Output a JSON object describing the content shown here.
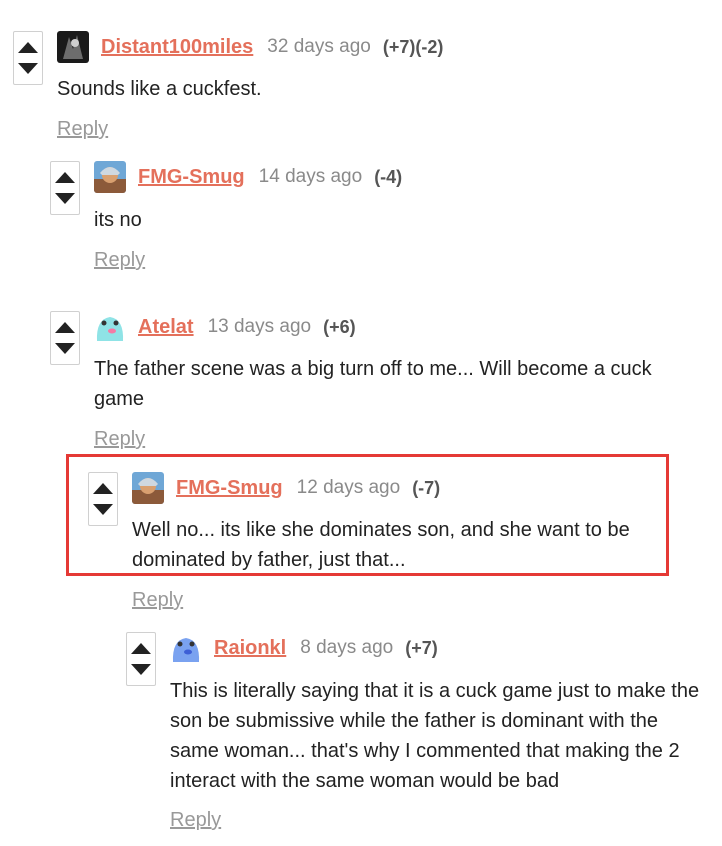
{
  "comments": [
    {
      "user": "Distant100miles",
      "time": "32 days ago",
      "score": "(+7)(-2)",
      "text": "Sounds like a cuckfest.",
      "reply": "Reply",
      "avatar": "dark-avatar"
    },
    {
      "user": "FMG-Smug",
      "time": "14 days ago",
      "score": "(-4)",
      "text": "its no",
      "reply": "Reply",
      "avatar": "knight-avatar"
    },
    {
      "user": "Atelat",
      "time": "13 days ago",
      "score": "(+6)",
      "text": "The father scene was a big turn off to me... Will become a cuck game",
      "reply": "Reply",
      "avatar": "cyan-blob-avatar"
    },
    {
      "user": "FMG-Smug",
      "time": "12 days ago",
      "score": "(-7)",
      "text": "Well no... its like she dominates son, and she want to be dominated by father, just that...",
      "reply": "Reply",
      "avatar": "knight-avatar"
    },
    {
      "user": "Raionkl",
      "time": "8 days ago",
      "score": "(+7)",
      "text": "This is literally saying that it is a cuck game just to make the son be submissive while the father is dominant with the same woman... that's why I commented that making the 2 interact with the same woman would be bad",
      "reply": "Reply",
      "avatar": "blue-blob-avatar"
    }
  ],
  "colors": {
    "username": "#e4705b",
    "highlight": "#e53935"
  }
}
